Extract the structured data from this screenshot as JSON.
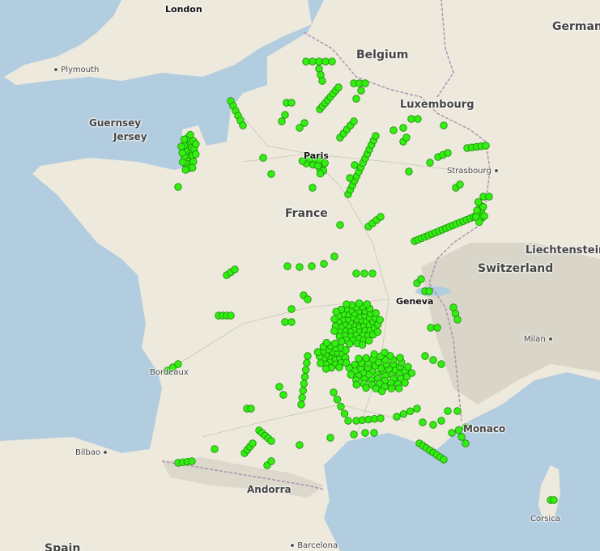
{
  "map": {
    "labels": {
      "london": "London",
      "germany": "German",
      "belgium": "Belgium",
      "plymouth": "Plymouth",
      "luxembourg": "Luxembourg",
      "guernsey": "Guernsey",
      "jersey": "Jersey",
      "paris": "Paris",
      "strasbourg": "Strasbourg",
      "france": "France",
      "liechtenstein": "Liechtenstein",
      "switzerland": "Switzerland",
      "geneva": "Geneva",
      "milan": "Milan",
      "bordeaux": "Bordeaux",
      "monaco": "Monaco",
      "bilbao": "Bilbao",
      "andorra": "Andorra",
      "corsica": "Corsica",
      "barcelona": "Barcelona",
      "spain": "Spain"
    },
    "colors": {
      "sea": "#b3cde0",
      "land": "#ede9dc",
      "mountains": "#d9d6c9",
      "marker_fill": "#33ee11",
      "marker_stroke": "#1c8a0a"
    }
  }
}
